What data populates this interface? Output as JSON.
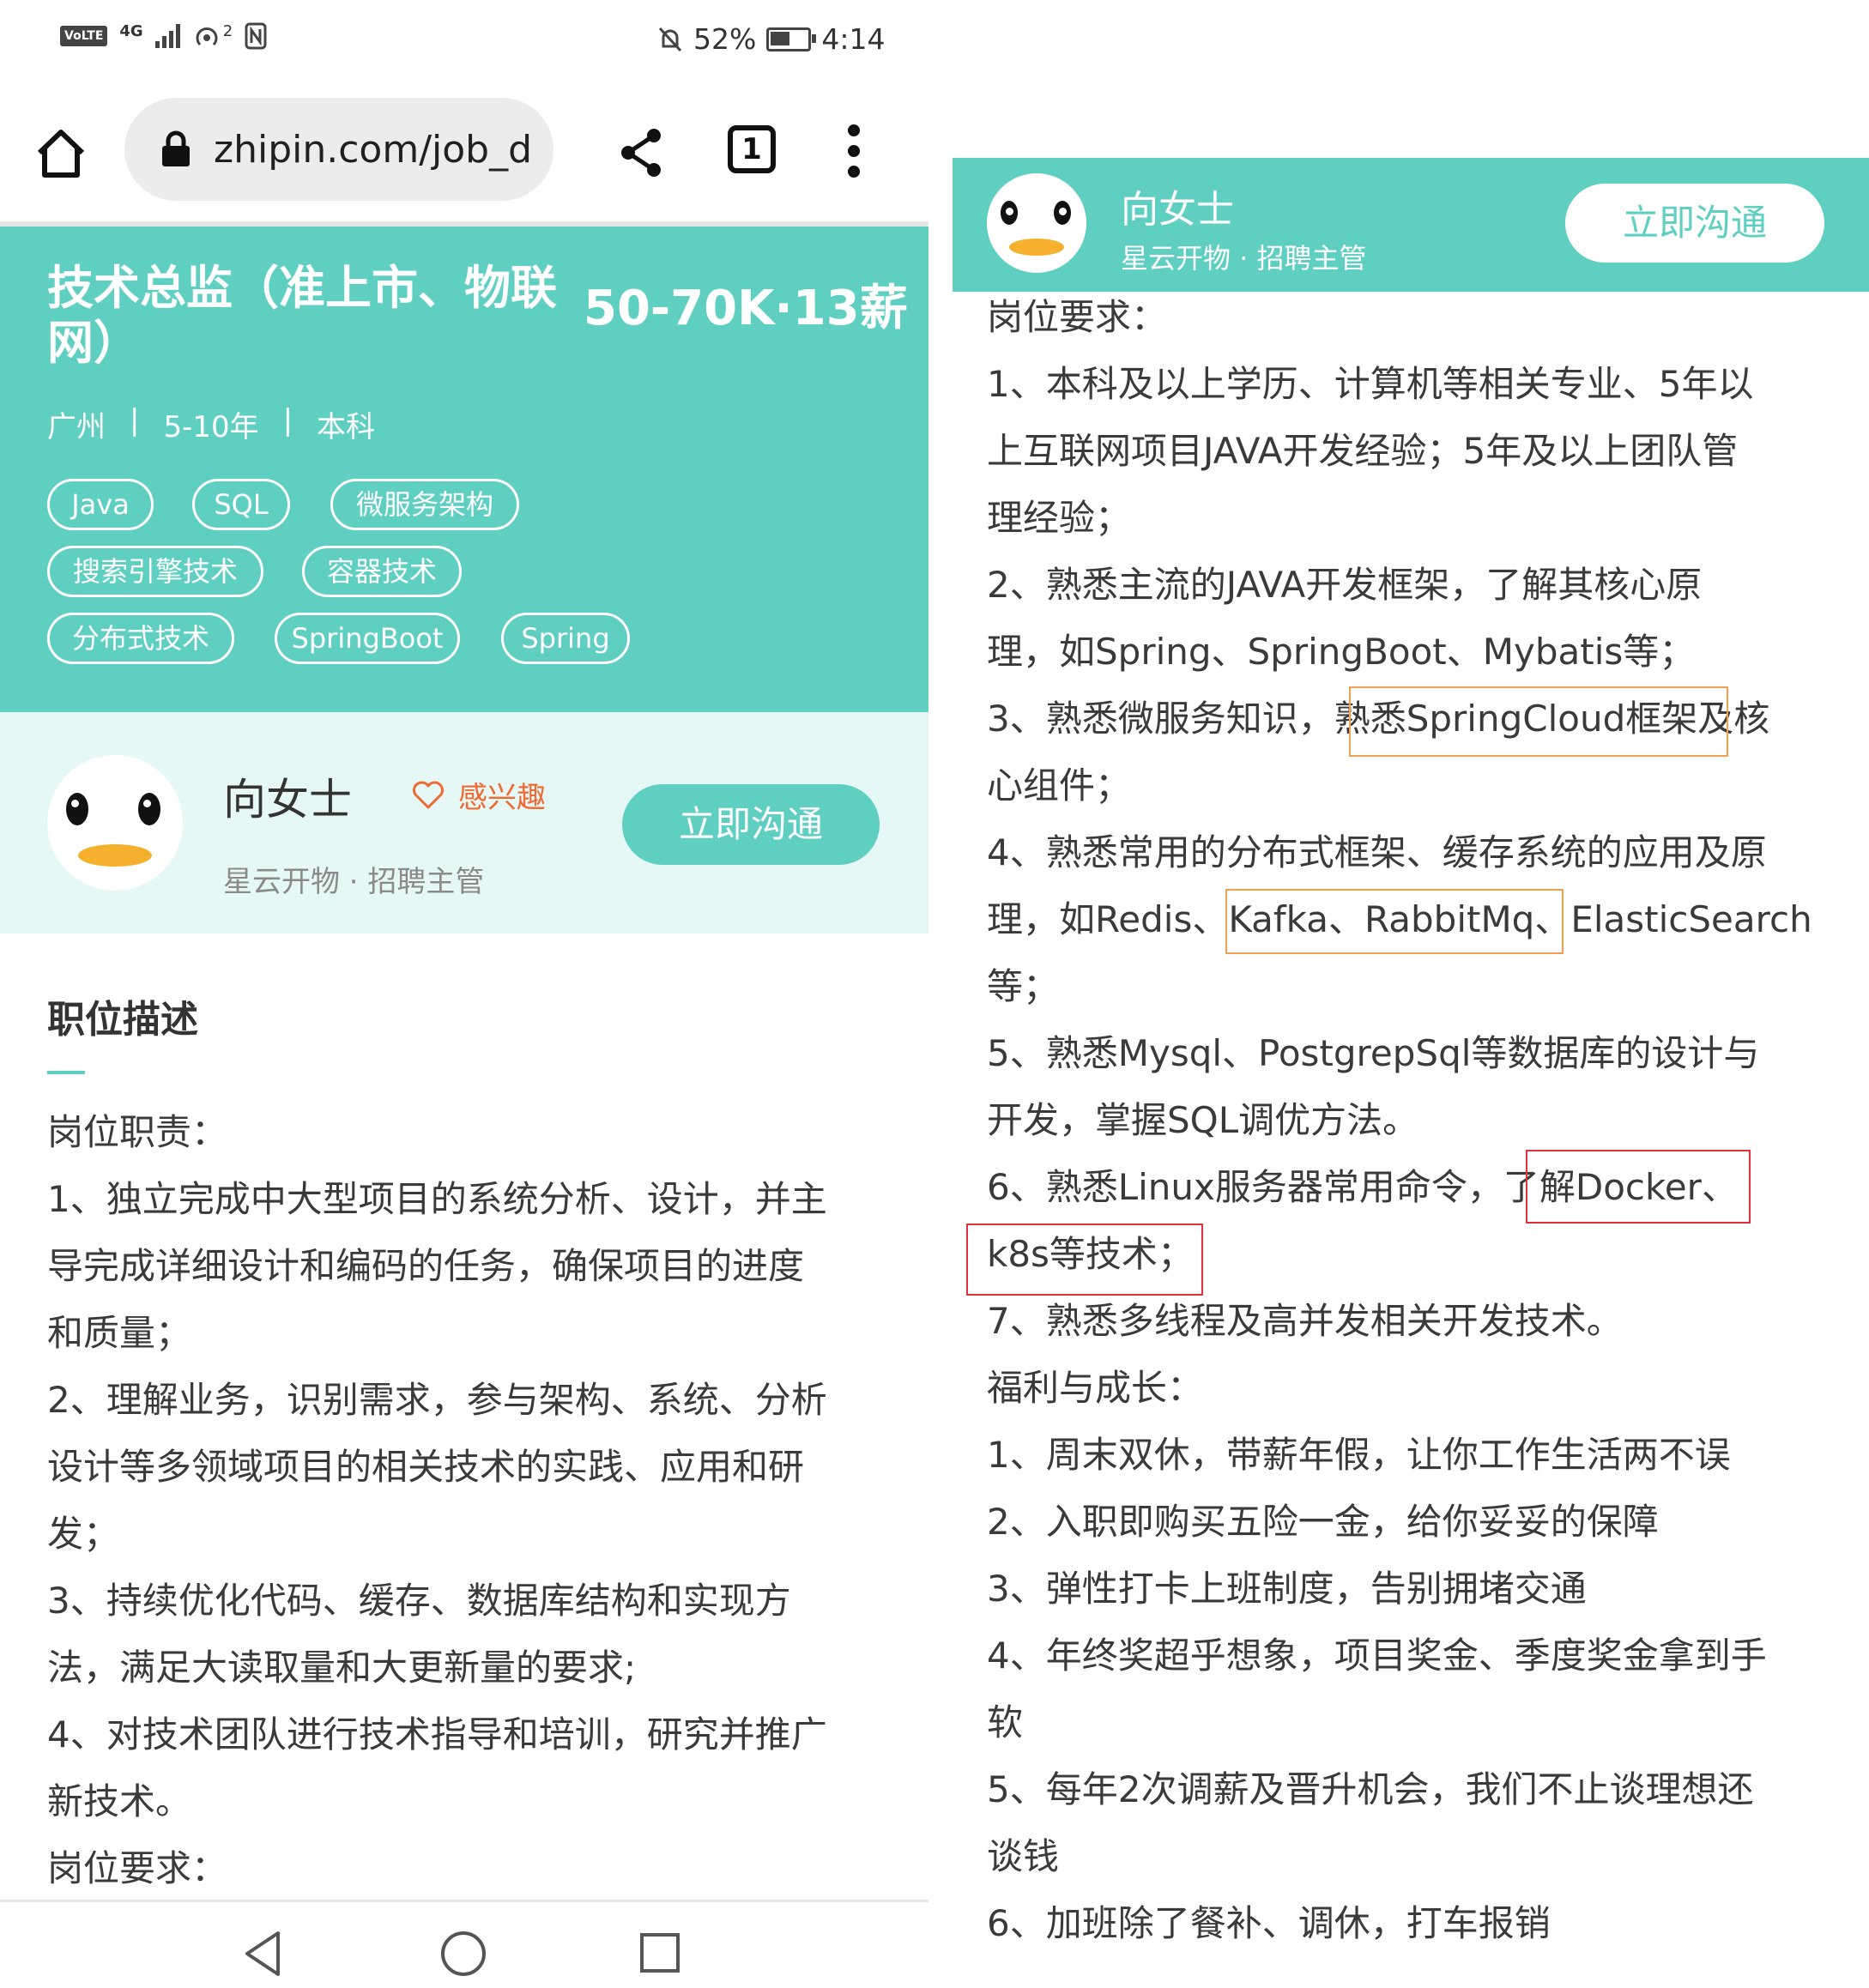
{
  "status_bar": {
    "volte": "VoLTE",
    "network": "4G",
    "wifi_badge": "2",
    "battery_pct": "52%",
    "time": "4:14"
  },
  "browser": {
    "url": "zhipin.com/job_d",
    "tab_count": "1"
  },
  "job": {
    "title": "技术总监（准上市、物联网）",
    "salary": "50-70K·13薪",
    "city": "广州",
    "sep1": "|",
    "experience": "5-10年",
    "sep2": "|",
    "education": "本科",
    "tags": [
      "Java",
      "SQL",
      "微服务架构",
      "搜索引擎技术",
      "容器技术",
      "分布式技术",
      "SpringBoot",
      "Spring"
    ]
  },
  "recruiter": {
    "name": "向女士",
    "interest_label": "感兴趣",
    "company_role": "星云开物 · 招聘主管",
    "chat_button": "立即沟通"
  },
  "description": {
    "section_title": "职位描述",
    "left_lines": [
      "岗位职责：",
      "1、独立完成中大型项目的系统分析、设计，并主",
      "导完成详细设计和编码的任务，确保项目的进度",
      "和质量；",
      "2、理解业务，识别需求，参与架构、系统、分析",
      "设计等多领域项目的相关技术的实践、应用和研",
      "发；",
      "3、持续优化代码、缓存、数据库结构和实现方",
      "法，满足大读取量和大更新量的要求;",
      "4、对技术团队进行技术指导和培训，研究并推广",
      "新技术。",
      "岗位要求："
    ],
    "right_lines": [
      "岗位要求：",
      "1、本科及以上学历、计算机等相关专业、5年以",
      "上互联网项目JAVA开发经验；5年及以上团队管",
      "理经验；",
      "2、熟悉主流的JAVA开发框架，了解其核心原",
      "理，如Spring、SpringBoot、Mybatis等；",
      "3、熟悉微服务知识，熟悉SpringCloud框架及核",
      "心组件；",
      "4、熟悉常用的分布式框架、缓存系统的应用及原",
      "理，如Redis、Kafka、RabbitMq、ElasticSearch",
      "等；",
      "5、熟悉Mysql、PostgrepSql等数据库的设计与",
      "开发，掌握SQL调优方法。",
      "6、熟悉Linux服务器常用命令，了解Docker、",
      "k8s等技术；",
      "7、熟悉多线程及高并发相关开发技术。",
      "福利与成长：",
      "1、周末双休，带薪年假，让你工作生活两不误",
      "2、入职即购买五险一金，给你妥妥的保障",
      "3、弹性打卡上班制度，告别拥堵交通",
      "4、年终奖超乎想象，项目奖金、季度奖金拿到手",
      "软",
      "5、每年2次调薪及晋升机会，我们不止谈理想还",
      "谈钱",
      "6、加班除了餐补、调休，打车报销"
    ]
  },
  "colors": {
    "brand": "#5fcfc2",
    "interest": "#ef6a32",
    "highlight_orange": "#f0a050",
    "highlight_red": "#e0303a"
  },
  "icons": [
    "home-icon",
    "lock-icon",
    "share-icon",
    "tabs-icon",
    "more-vert-icon",
    "heart-icon",
    "back-nav-icon",
    "home-nav-icon",
    "recents-nav-icon"
  ]
}
